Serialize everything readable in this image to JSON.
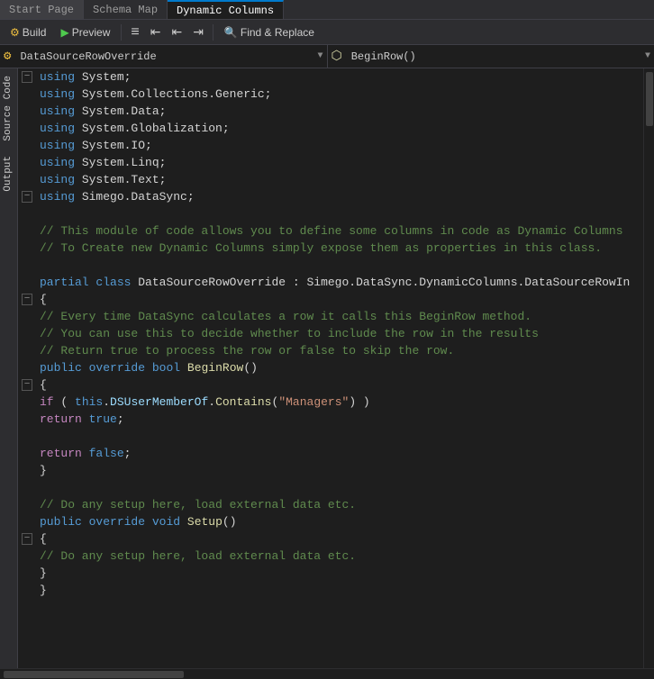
{
  "tabs": [
    {
      "id": "start-page",
      "label": "Start Page",
      "active": false
    },
    {
      "id": "schema-map",
      "label": "Schema Map",
      "active": false
    },
    {
      "id": "dynamic-columns",
      "label": "Dynamic Columns",
      "active": true
    }
  ],
  "toolbar": {
    "build_label": "Build",
    "preview_label": "Preview",
    "find_replace_label": "Find & Replace",
    "btn_icon_indent1": "≡",
    "btn_icon_indent2": "⇐",
    "btn_icon_indent3": "⇐",
    "btn_icon_indent4": "⇒"
  },
  "dropdowns": {
    "left_value": "DataSourceRowOverride",
    "left_icon": "settings",
    "right_value": "BeginRow()",
    "right_icon": "function"
  },
  "side_labels": {
    "source_code": "Source Code",
    "output": "Output"
  },
  "code": {
    "lines": [
      {
        "indent": 0,
        "collapse": "minus",
        "content": [
          {
            "t": "kw",
            "v": "using"
          },
          {
            "t": "plain",
            "v": " System;"
          }
        ]
      },
      {
        "indent": 0,
        "collapse": "",
        "content": [
          {
            "t": "kw",
            "v": "using"
          },
          {
            "t": "plain",
            "v": " System.Collections.Generic;"
          }
        ]
      },
      {
        "indent": 0,
        "collapse": "",
        "content": [
          {
            "t": "kw",
            "v": "using"
          },
          {
            "t": "plain",
            "v": " System.Data;"
          }
        ]
      },
      {
        "indent": 0,
        "collapse": "",
        "content": [
          {
            "t": "kw",
            "v": "using"
          },
          {
            "t": "plain",
            "v": " System.Globalization;"
          }
        ]
      },
      {
        "indent": 0,
        "collapse": "",
        "content": [
          {
            "t": "kw",
            "v": "using"
          },
          {
            "t": "plain",
            "v": " System.IO;"
          }
        ]
      },
      {
        "indent": 0,
        "collapse": "",
        "content": [
          {
            "t": "kw",
            "v": "using"
          },
          {
            "t": "plain",
            "v": " System.Linq;"
          }
        ]
      },
      {
        "indent": 0,
        "collapse": "",
        "content": [
          {
            "t": "kw",
            "v": "using"
          },
          {
            "t": "plain",
            "v": " System.Text;"
          }
        ]
      },
      {
        "indent": 0,
        "collapse": "minus",
        "content": [
          {
            "t": "kw",
            "v": "using"
          },
          {
            "t": "plain",
            "v": " Simego.DataSync;"
          }
        ]
      },
      {
        "indent": 0,
        "collapse": "",
        "content": [
          {
            "t": "plain",
            "v": ""
          }
        ]
      },
      {
        "indent": 0,
        "collapse": "",
        "content": [
          {
            "t": "comment",
            "v": "// This module of code allows you to define some columns in code as Dynamic Columns"
          }
        ]
      },
      {
        "indent": 0,
        "collapse": "",
        "content": [
          {
            "t": "comment",
            "v": "// To Create new Dynamic Columns simply expose them as properties in this class."
          }
        ]
      },
      {
        "indent": 0,
        "collapse": "",
        "content": [
          {
            "t": "plain",
            "v": ""
          }
        ]
      },
      {
        "indent": 0,
        "collapse": "",
        "content": [
          {
            "t": "kw",
            "v": "partial"
          },
          {
            "t": "plain",
            "v": " "
          },
          {
            "t": "kw",
            "v": "class"
          },
          {
            "t": "plain",
            "v": " DataSourceRowOverride : Simego.DataSync.DynamicColumns.DataSourceRowIn"
          }
        ]
      },
      {
        "indent": 0,
        "collapse": "minus",
        "content": [
          {
            "t": "plain",
            "v": "{"
          }
        ]
      },
      {
        "indent": 8,
        "collapse": "",
        "content": [
          {
            "t": "comment",
            "v": "// Every time DataSync calculates a row it calls this BeginRow method."
          }
        ]
      },
      {
        "indent": 8,
        "collapse": "",
        "content": [
          {
            "t": "comment",
            "v": "// You can use this to decide whether to include the row in the results"
          }
        ]
      },
      {
        "indent": 8,
        "collapse": "",
        "content": [
          {
            "t": "comment",
            "v": "// Return true to process the row or false to skip the row."
          }
        ]
      },
      {
        "indent": 8,
        "collapse": "",
        "content": [
          {
            "t": "kw",
            "v": "public"
          },
          {
            "t": "plain",
            "v": " "
          },
          {
            "t": "kw",
            "v": "override"
          },
          {
            "t": "plain",
            "v": " "
          },
          {
            "t": "kw",
            "v": "bool"
          },
          {
            "t": "plain",
            "v": " "
          },
          {
            "t": "method",
            "v": "BeginRow"
          },
          {
            "t": "plain",
            "v": "()"
          }
        ]
      },
      {
        "indent": 8,
        "collapse": "minus",
        "content": [
          {
            "t": "plain",
            "v": "{"
          }
        ]
      },
      {
        "indent": 16,
        "collapse": "",
        "content": [
          {
            "t": "kw2",
            "v": "if"
          },
          {
            "t": "plain",
            "v": " ( "
          },
          {
            "t": "kw",
            "v": "this"
          },
          {
            "t": "plain",
            "v": "."
          },
          {
            "t": "prop",
            "v": "DSUserMemberOf"
          },
          {
            "t": "plain",
            "v": "."
          },
          {
            "t": "method",
            "v": "Contains"
          },
          {
            "t": "plain",
            "v": "("
          },
          {
            "t": "str",
            "v": "\"Managers\""
          },
          {
            "t": "plain",
            "v": ") )"
          }
        ]
      },
      {
        "indent": 24,
        "collapse": "",
        "content": [
          {
            "t": "kw2",
            "v": "return"
          },
          {
            "t": "plain",
            "v": " "
          },
          {
            "t": "bool",
            "v": "true"
          },
          {
            "t": "plain",
            "v": ";"
          }
        ]
      },
      {
        "indent": 8,
        "collapse": "",
        "content": [
          {
            "t": "plain",
            "v": ""
          }
        ]
      },
      {
        "indent": 16,
        "collapse": "",
        "content": [
          {
            "t": "kw2",
            "v": "return"
          },
          {
            "t": "plain",
            "v": " "
          },
          {
            "t": "bool",
            "v": "false"
          },
          {
            "t": "plain",
            "v": ";"
          }
        ]
      },
      {
        "indent": 8,
        "collapse": "",
        "content": [
          {
            "t": "plain",
            "v": "}"
          }
        ]
      },
      {
        "indent": 0,
        "collapse": "",
        "content": [
          {
            "t": "plain",
            "v": ""
          }
        ]
      },
      {
        "indent": 8,
        "collapse": "",
        "content": [
          {
            "t": "comment",
            "v": "// Do any setup here, load external data etc."
          }
        ]
      },
      {
        "indent": 8,
        "collapse": "",
        "content": [
          {
            "t": "kw",
            "v": "public"
          },
          {
            "t": "plain",
            "v": " "
          },
          {
            "t": "kw",
            "v": "override"
          },
          {
            "t": "plain",
            "v": " "
          },
          {
            "t": "kw",
            "v": "void"
          },
          {
            "t": "plain",
            "v": " "
          },
          {
            "t": "method",
            "v": "Setup"
          },
          {
            "t": "plain",
            "v": "()"
          }
        ]
      },
      {
        "indent": 8,
        "collapse": "minus",
        "content": [
          {
            "t": "plain",
            "v": "{"
          }
        ]
      },
      {
        "indent": 16,
        "collapse": "",
        "content": [
          {
            "t": "comment",
            "v": "// Do any setup here, load external data etc."
          }
        ]
      },
      {
        "indent": 8,
        "collapse": "",
        "content": [
          {
            "t": "plain",
            "v": "}"
          }
        ]
      },
      {
        "indent": 0,
        "collapse": "",
        "content": [
          {
            "t": "plain",
            "v": "}"
          }
        ]
      }
    ]
  }
}
